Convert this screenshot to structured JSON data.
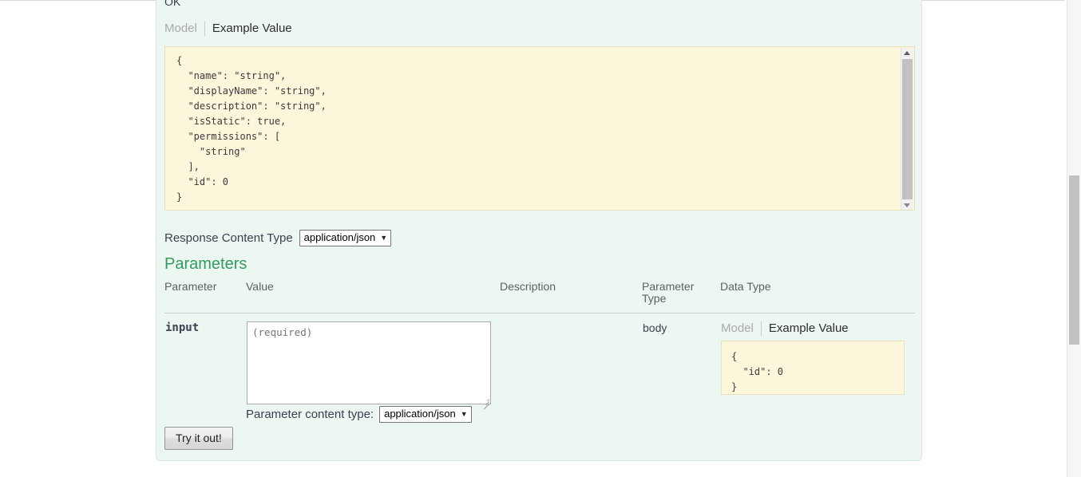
{
  "response": {
    "status_label": "OK",
    "tabs": [
      {
        "label": "Model",
        "active": false
      },
      {
        "label": "Example Value",
        "active": true
      }
    ],
    "example_value": "{\n  \"name\": \"string\",\n  \"displayName\": \"string\",\n  \"description\": \"string\",\n  \"isStatic\": true,\n  \"permissions\": [\n    \"string\"\n  ],\n  \"id\": 0\n}",
    "content_type_label": "Response Content Type",
    "content_type_value": "application/json",
    "caret_glyph": "▼"
  },
  "parameters_section": {
    "heading": "Parameters",
    "columns": [
      "Parameter",
      "Value",
      "Description",
      "Parameter Type",
      "Data Type"
    ],
    "rows": [
      {
        "parameter": "input",
        "value_placeholder": "(required)",
        "value": "",
        "description": "",
        "parameter_type": "body",
        "data_type": {
          "tabs": [
            {
              "label": "Model",
              "active": false
            },
            {
              "label": "Example Value",
              "active": true
            }
          ],
          "example_value": "{\n  \"id\": 0\n}"
        }
      }
    ],
    "content_type_label": "Parameter content type:",
    "content_type_value": "application/json",
    "try_it_out_label": "Try it out!"
  },
  "colors": {
    "panel_background": "#ebf7f0",
    "panel_border": "#d5ead9",
    "code_background": "#fcf6db",
    "code_border": "#e8e0bf",
    "heading_green": "#319a5e",
    "muted_text": "#aaaaaa",
    "body_text": "#3b4151"
  }
}
